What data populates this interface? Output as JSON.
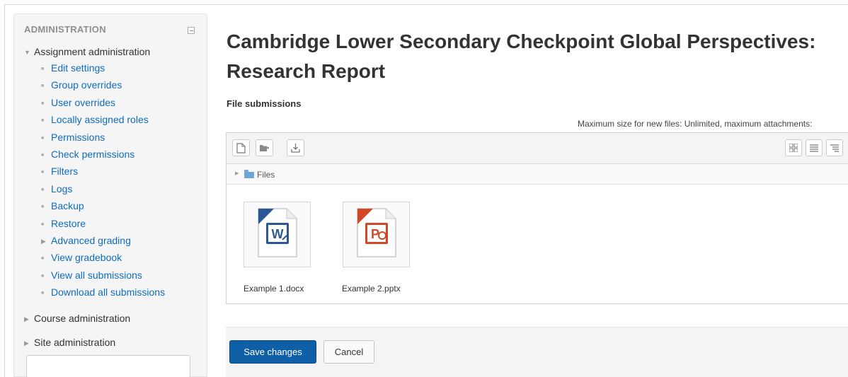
{
  "sidebar": {
    "header": "ADMINISTRATION",
    "collapse_icon": "collapse-icon",
    "assignment_admin": {
      "label": "Assignment administration",
      "expanded": true
    },
    "items": [
      {
        "label": "Edit settings",
        "icon": "bullet"
      },
      {
        "label": "Group overrides",
        "icon": "bullet"
      },
      {
        "label": "User overrides",
        "icon": "bullet"
      },
      {
        "label": "Locally assigned roles",
        "icon": "bullet"
      },
      {
        "label": "Permissions",
        "icon": "bullet"
      },
      {
        "label": "Check permissions",
        "icon": "bullet"
      },
      {
        "label": "Filters",
        "icon": "bullet"
      },
      {
        "label": "Logs",
        "icon": "bullet"
      },
      {
        "label": "Backup",
        "icon": "bullet"
      },
      {
        "label": "Restore",
        "icon": "bullet"
      },
      {
        "label": "Advanced grading",
        "icon": "expand-arrow"
      },
      {
        "label": "View gradebook",
        "icon": "bullet"
      },
      {
        "label": "View all submissions",
        "icon": "bullet"
      },
      {
        "label": "Download all submissions",
        "icon": "bullet"
      }
    ],
    "course_admin": {
      "label": "Course administration"
    },
    "site_admin": {
      "label": "Site administration"
    },
    "search": {
      "value": "",
      "placeholder": ""
    }
  },
  "main": {
    "title": "Cambridge Lower Secondary Checkpoint Global Perspectives: Research Report",
    "file_submissions_label": "File submissions",
    "max_info": "Maximum size for new files: Unlimited, maximum attachments:",
    "toolbar": {
      "icons": [
        "add-file-icon",
        "create-folder-icon",
        "download-icon"
      ],
      "view_icons": [
        "icon-view-icon",
        "list-view-icon",
        "tree-view-icon"
      ]
    },
    "path": {
      "label": "Files"
    },
    "files": [
      {
        "name": "Example 1.docx",
        "type": "word",
        "color": "#2b5797",
        "letter": "W"
      },
      {
        "name": "Example 2.pptx",
        "type": "powerpoint",
        "color": "#d24726",
        "letter": "P"
      }
    ],
    "buttons": {
      "save": "Save changes",
      "cancel": "Cancel"
    }
  },
  "colors": {
    "link": "#0f6cbf",
    "primary": "#0f5fa6"
  }
}
